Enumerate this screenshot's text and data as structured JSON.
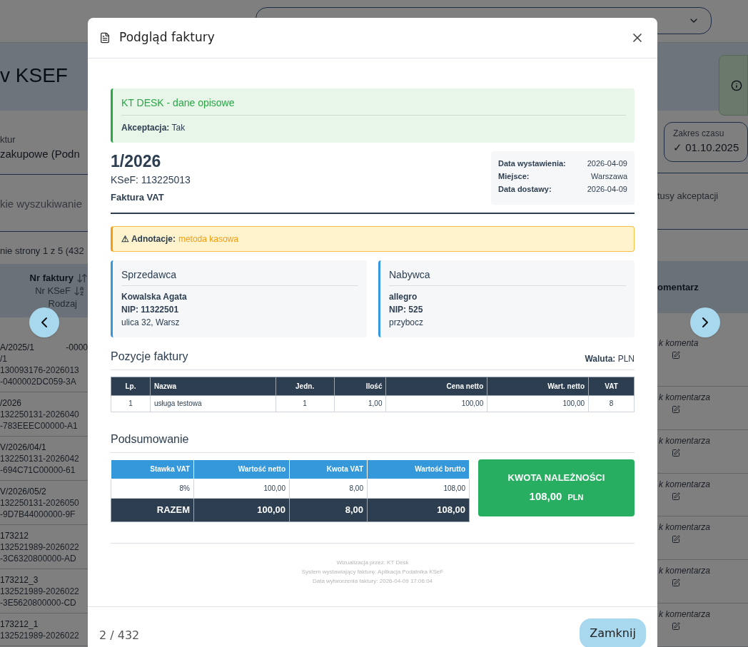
{
  "background_page": {
    "title": "v KSEF",
    "filter": {
      "label": "ktur",
      "value": "zakupowe (Podn"
    },
    "search": {
      "placeholder": "kie wyszukiwanie"
    },
    "pagination": "nie strony 1 z 5 (432",
    "time_range": {
      "label": "Zakres czasu",
      "value": "✓ 01.10.2025"
    },
    "status_filter": "tusy akceptacji",
    "table": {
      "column_1": {
        "title": "Nr faktury",
        "subtitle": "Nr KSeF",
        "third": "Rodzaj"
      },
      "column_2": "omentarz",
      "rows": [
        {
          "number_parts": [
            "A/2025/1",
            "-0000"
          ],
          "lines": [
            "/1",
            "130093176-2026013",
            "-0400002DC059-3A"
          ],
          "comment": "k komenta"
        },
        {
          "number_parts": [
            "/2026"
          ],
          "lines": [
            "132250131-2026040",
            "-783EEEC00000-A1"
          ],
          "comment": "k komentarza"
        },
        {
          "number_parts": [
            "V/2026/04/1"
          ],
          "lines": [
            "132250131-2026042",
            "-694C71C00000-61"
          ],
          "comment": "k komentarza"
        },
        {
          "number_parts": [
            "V/2026/05/2"
          ],
          "lines": [
            "132250131-2026050",
            "-9D7B44000000-9F"
          ],
          "comment": "k komentarza"
        },
        {
          "number_parts": [
            "173212"
          ],
          "lines": [
            "132521989-2026022",
            "-3C6320800000-AD"
          ],
          "comment": "k komentarza"
        },
        {
          "number_parts": [
            "173212_3"
          ],
          "lines": [
            "132521989-2026022",
            "-3E5620800000-CD"
          ],
          "comment": "k komentarza"
        },
        {
          "number_parts": [
            "173212_1"
          ],
          "lines": [
            "132521989-2026022"
          ],
          "comment": "k komentarza"
        }
      ]
    }
  },
  "modal": {
    "title": "Podgląd faktury",
    "description_box": {
      "title": "KT DESK - dane opisowe",
      "text": "**Akceptacja:** Tak"
    },
    "invoice": {
      "number": "1/2026",
      "ksef": "KSeF: 113225013",
      "type": "Faktura VAT",
      "details": [
        {
          "label": "Data wystawienia:",
          "value": "2026-04-09"
        },
        {
          "label": "Miejsce:",
          "value": "Warszawa"
        },
        {
          "label": "Data dostawy:",
          "value": "2026-04-09"
        }
      ]
    },
    "annotation": {
      "label": "⚠ Adnotacje:",
      "value": "metoda kasowa"
    },
    "parties": [
      {
        "title": "Sprzedawca",
        "name": "Kowalska Agata",
        "nip": "NIP: 11322501",
        "address": "ulica 32, Warsz"
      },
      {
        "title": "Nabywca",
        "name": "allegro",
        "nip": "NIP: 525",
        "address": "przybocz"
      }
    ],
    "items": {
      "title": "Pozycje faktury",
      "currency": "**Waluta:** PLN",
      "columns": [
        "Lp.",
        "Nazwa",
        "Jedn.",
        "Ilość",
        "Cena netto",
        "Wart. netto",
        "VAT"
      ],
      "rows": [
        [
          "1",
          "usługa testowa",
          "1",
          "1,00",
          "100,00",
          "100,00",
          "8"
        ]
      ]
    },
    "summary": {
      "title": "Podsumowanie",
      "columns": [
        "Stawka VAT",
        "Wartość netto",
        "Kwota VAT",
        "Wartość brutto"
      ],
      "rows": [
        [
          "8%",
          "100,00",
          "8,00",
          "108,00"
        ]
      ],
      "total": [
        "RAZEM",
        "100,00",
        "8,00",
        "108,00"
      ],
      "due": {
        "label": "KWOTA NALEŻNOŚCI",
        "amount": "108,00",
        "currency": "PLN"
      }
    },
    "footer_notes": [
      "Wizualizacja przez: KT Desk",
      "System wystawiający fakturę: Aplikacja Podatnika KSeF",
      "Data wytworzenia faktury: 2026-04-09 17:06:04"
    ],
    "counter": "2 / 432",
    "close_button": "Zamknij"
  }
}
